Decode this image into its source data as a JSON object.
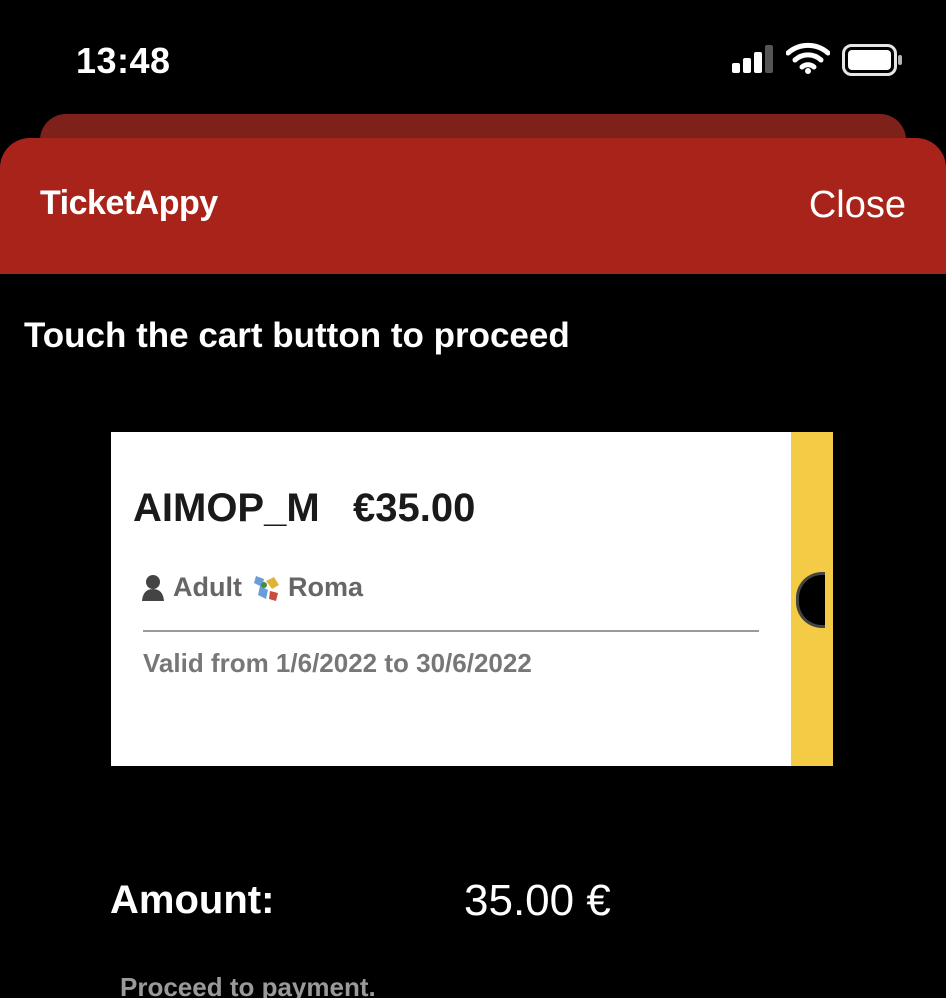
{
  "status_bar": {
    "time": "13:48",
    "icons": [
      "signal-icon",
      "wifi-icon",
      "battery-icon"
    ]
  },
  "header": {
    "logo": "TicketAppy",
    "close_label": "Close",
    "color": "#a8241a"
  },
  "instruction": "Touch the cart button to proceed",
  "ticket": {
    "code": "AIMOP_M",
    "price": "€35.00",
    "passenger_type": "Adult",
    "zone": "Roma",
    "validity": "Valid from 1/6/2022 to 30/6/2022",
    "strip_color": "#f4cb44",
    "icons": [
      "person-icon",
      "map-icon"
    ]
  },
  "amount": {
    "label": "Amount:",
    "value": "35.00 €"
  },
  "proceed_label": "Proceed to payment."
}
